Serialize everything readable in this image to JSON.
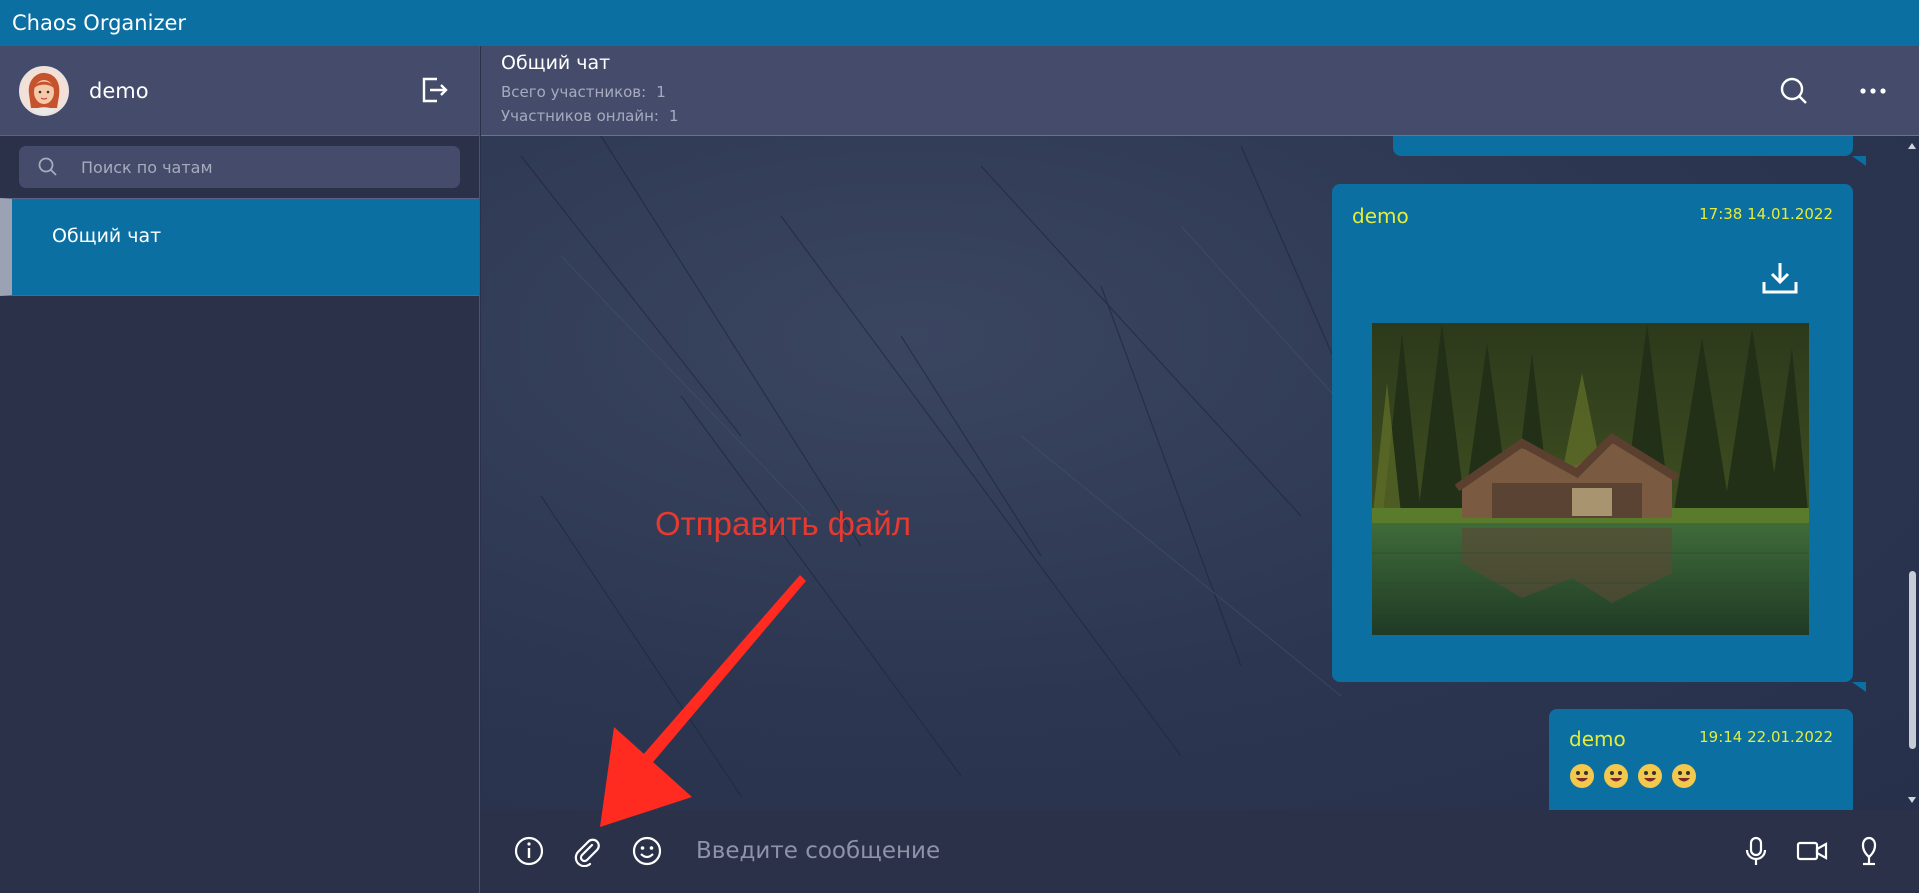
{
  "app": {
    "title": "Chaos Organizer"
  },
  "user": {
    "name": "demo"
  },
  "sidebar": {
    "search_placeholder": "Поиск по чатам",
    "chats": [
      {
        "label": "Общий чат"
      }
    ]
  },
  "chat": {
    "title": "Общий чат",
    "participants_label": "Всего участников:",
    "participants_value": "1",
    "online_label": "Участников онлайн:",
    "online_value": "1"
  },
  "messages": [
    {
      "author": "demo",
      "time": "17:38 14.01.2022",
      "type": "image"
    },
    {
      "author": "demo",
      "time": "19:14 22.01.2022",
      "type": "text",
      "emoji_count": 4
    }
  ],
  "composer": {
    "placeholder": "Введите сообщение"
  },
  "annotation": {
    "text": "Отправить файл"
  },
  "colors": {
    "accent": "#0b6fa2",
    "panel": "#454c6b",
    "background": "#2b3148",
    "author_text": "#e3ed3b",
    "annotation": "#e63a30"
  },
  "icons": {
    "header": [
      "search-icon",
      "more-icon"
    ],
    "composer_left": [
      "info-icon",
      "paperclip-icon",
      "smiley-icon"
    ],
    "composer_right": [
      "microphone-icon",
      "video-camera-icon",
      "location-icon"
    ]
  }
}
